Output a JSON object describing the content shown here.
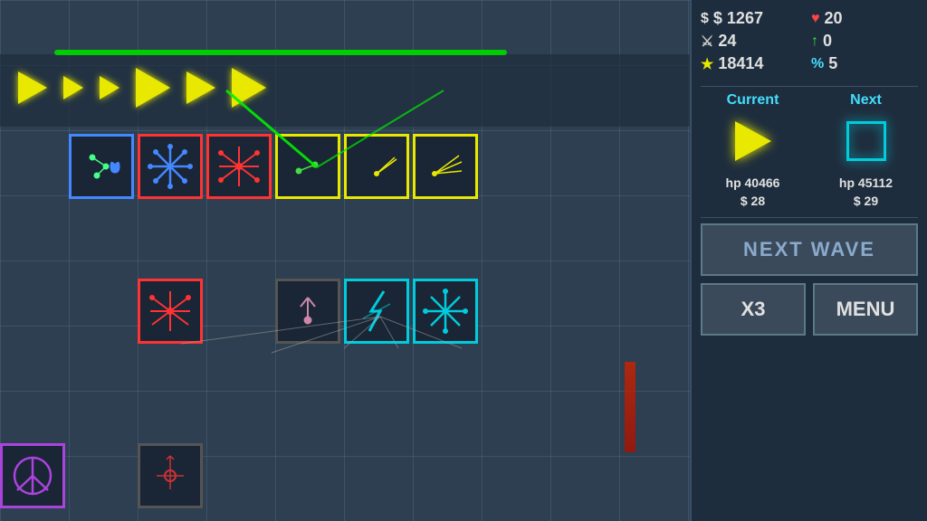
{
  "stats": {
    "money": "$ 1267",
    "hearts": "20",
    "sword": "24",
    "arrow_up": "0",
    "star_score": "18414",
    "percent": "5",
    "money_icon": "$",
    "heart_icon": "♥",
    "sword_icon": "⚔",
    "star_icon": "★",
    "percent_icon": "%"
  },
  "current_next": {
    "current_label": "Current",
    "next_label": "Next",
    "current_hp": "hp 40466",
    "next_hp": "hp 45112",
    "current_cost": "$ 28",
    "next_cost": "$ 29"
  },
  "buttons": {
    "next_wave": "NEXT WAVE",
    "speed": "X3",
    "menu": "MENU"
  }
}
